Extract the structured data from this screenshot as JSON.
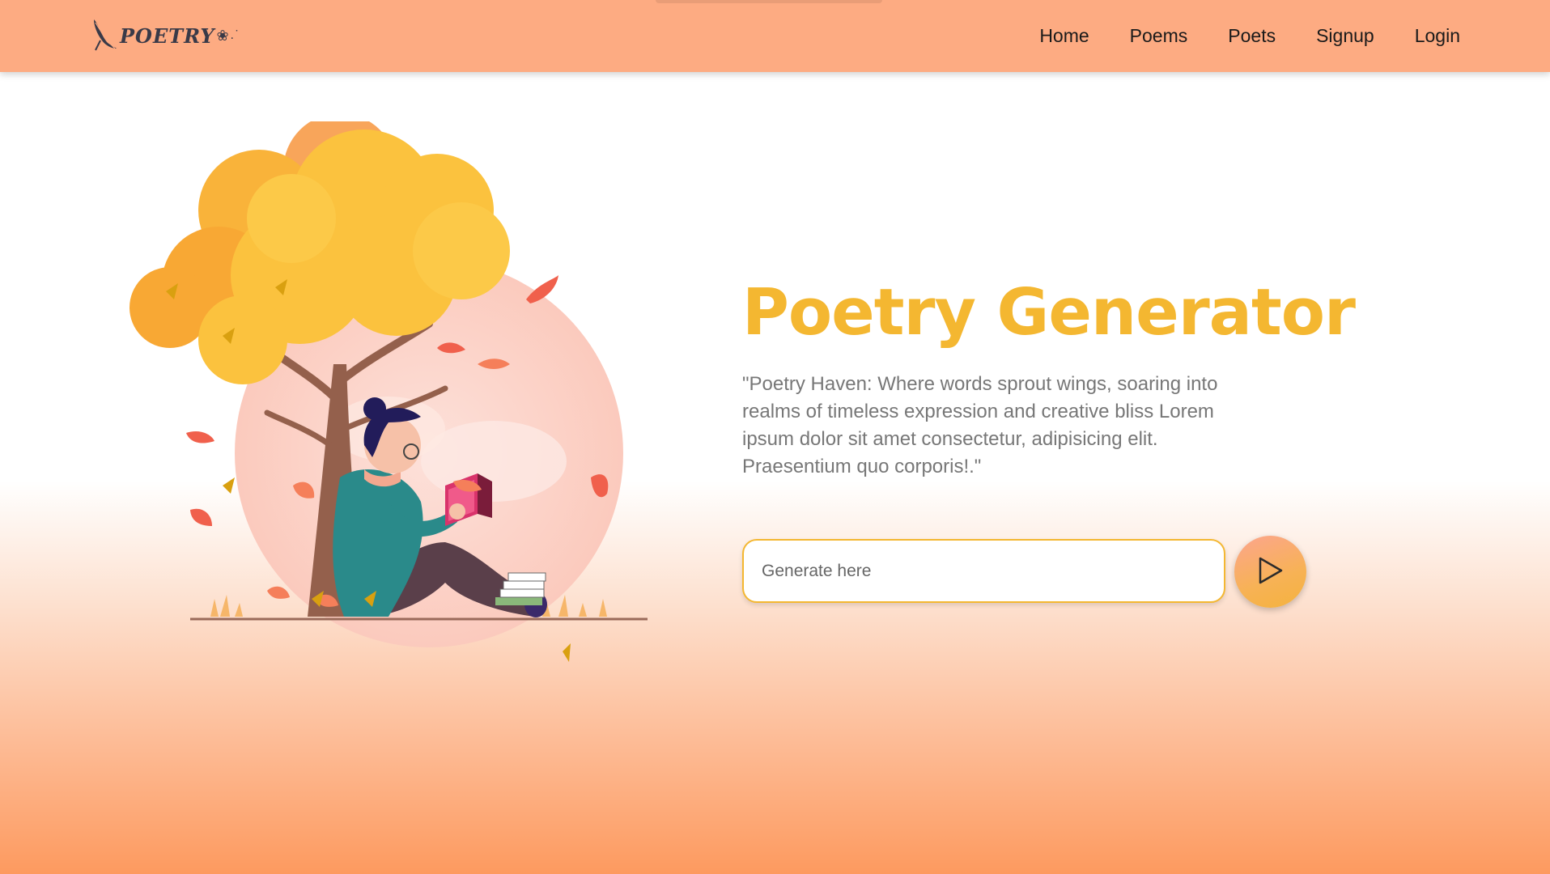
{
  "navbar": {
    "logo_text": "POETRY",
    "logo_icon": "feather-quill-icon",
    "links": [
      {
        "label": "Home"
      },
      {
        "label": "Poems"
      },
      {
        "label": "Poets"
      },
      {
        "label": "Signup"
      },
      {
        "label": "Login"
      }
    ]
  },
  "hero": {
    "title": "Poetry Generator",
    "description": "\"Poetry Haven: Where words sprout wings, soaring into realms of timeless expression and creative bliss Lorem ipsum dolor sit amet consectetur, adipisicing elit. Praesentium quo corporis!.\"",
    "input_placeholder": "Generate here",
    "input_value": "",
    "generate_icon": "play-triangle-icon"
  },
  "illustration": {
    "description_icon": "reading-under-tree-illustration"
  },
  "colors": {
    "navbar_bg": "#fdab82",
    "title_accent": "#f4b731",
    "input_border": "#f4b731",
    "button_gradient_start": "#fca58e",
    "button_gradient_end": "#f4b33e"
  }
}
